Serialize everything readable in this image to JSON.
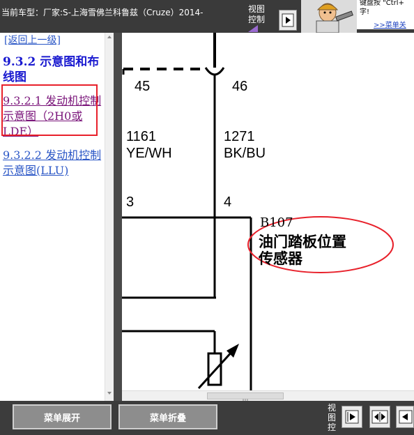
{
  "header": {
    "vehicle_info": "当前车型：厂家:S-上海雪佛兰科鲁兹（Cruze）2014-",
    "view_control_label": "视图控制",
    "tip_line1": "键盘按 \"Ctrl+",
    "tip_line2": "字!",
    "menu_close_link": ">>菜单关"
  },
  "sidebar": {
    "back_link": "[返回上一级]",
    "section_title": "9.3.2 示意图和布线图",
    "items": [
      {
        "label": "9.3.2.1 发动机控制示意图（2H0或LDE）"
      },
      {
        "label": "9.3.2.2 发动机控制示意图(LLU)"
      }
    ]
  },
  "diagram": {
    "pin_left": "45",
    "pin_right": "46",
    "wire_left_id": "1161",
    "wire_left_color": "YE/WH",
    "wire_right_id": "1271",
    "wire_right_color": "BK/BU",
    "conn_left": "3",
    "conn_right": "4",
    "component_id": "B107",
    "component_name_line1": "油门踏板位置",
    "component_name_line2": "传感器"
  },
  "footer": {
    "expand_label": "菜单展开",
    "collapse_label": "菜单折叠",
    "view_control_label": "视图控"
  },
  "colors": {
    "highlight": "#e8202a",
    "link": "#2a56c6",
    "visited": "#7a147a",
    "section": "#1a1ad0"
  }
}
